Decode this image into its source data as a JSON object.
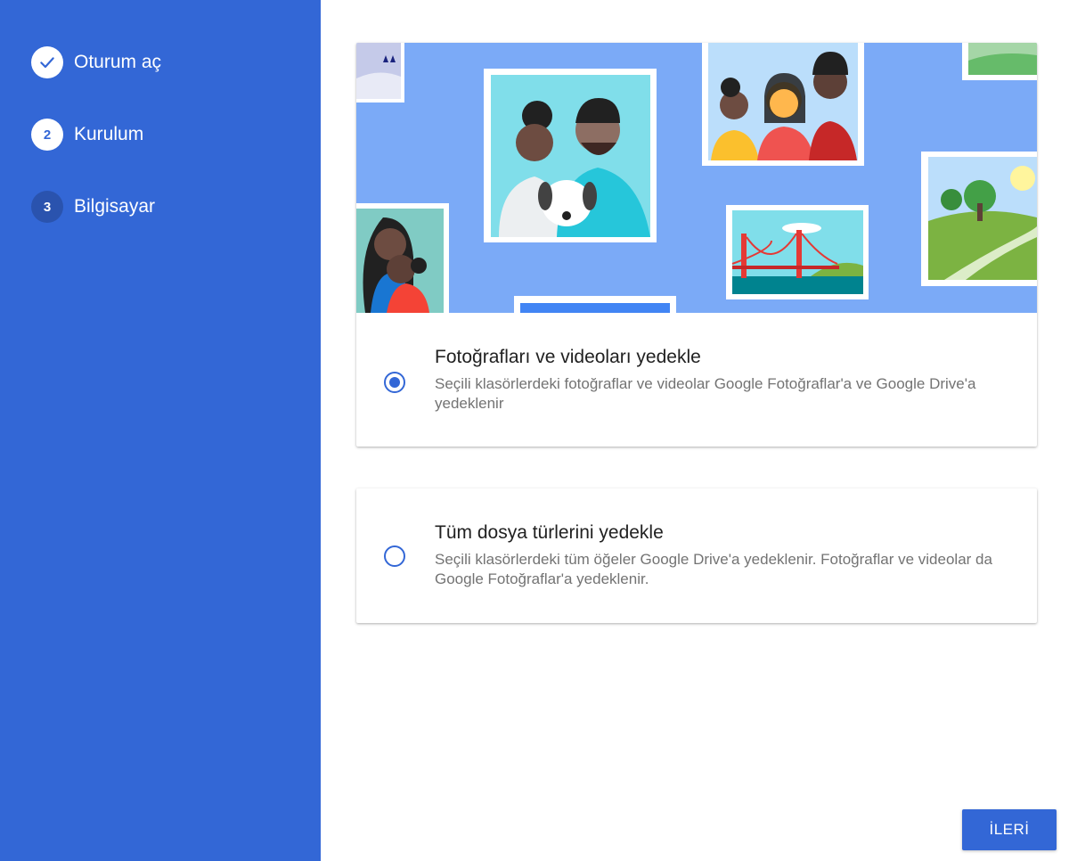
{
  "steps": [
    {
      "number": "",
      "label": "Oturum aç",
      "state": "done",
      "icon": "check-icon"
    },
    {
      "number": "2",
      "label": "Kurulum",
      "state": "active"
    },
    {
      "number": "3",
      "label": "Bilgisayar",
      "state": "pending"
    }
  ],
  "options": [
    {
      "title": "Fotoğrafları ve videoları yedekle",
      "description": "Seçili klasörlerdeki fotoğraflar ve videolar Google Fotoğraflar'a ve Google Drive'a yedeklenir",
      "selected": true
    },
    {
      "title": "Tüm dosya türlerini yedekle",
      "description": "Seçili klasörlerdeki tüm öğeler Google Drive'a yedeklenir. Fotoğraflar ve videolar da Google Fotoğraflar'a yedeklenir.",
      "selected": false
    }
  ],
  "footer": {
    "next_label": "İLERİ"
  },
  "colors": {
    "sidebar": "#3367d6",
    "accent": "#3367d6",
    "hero_bg": "#7baaf7"
  }
}
